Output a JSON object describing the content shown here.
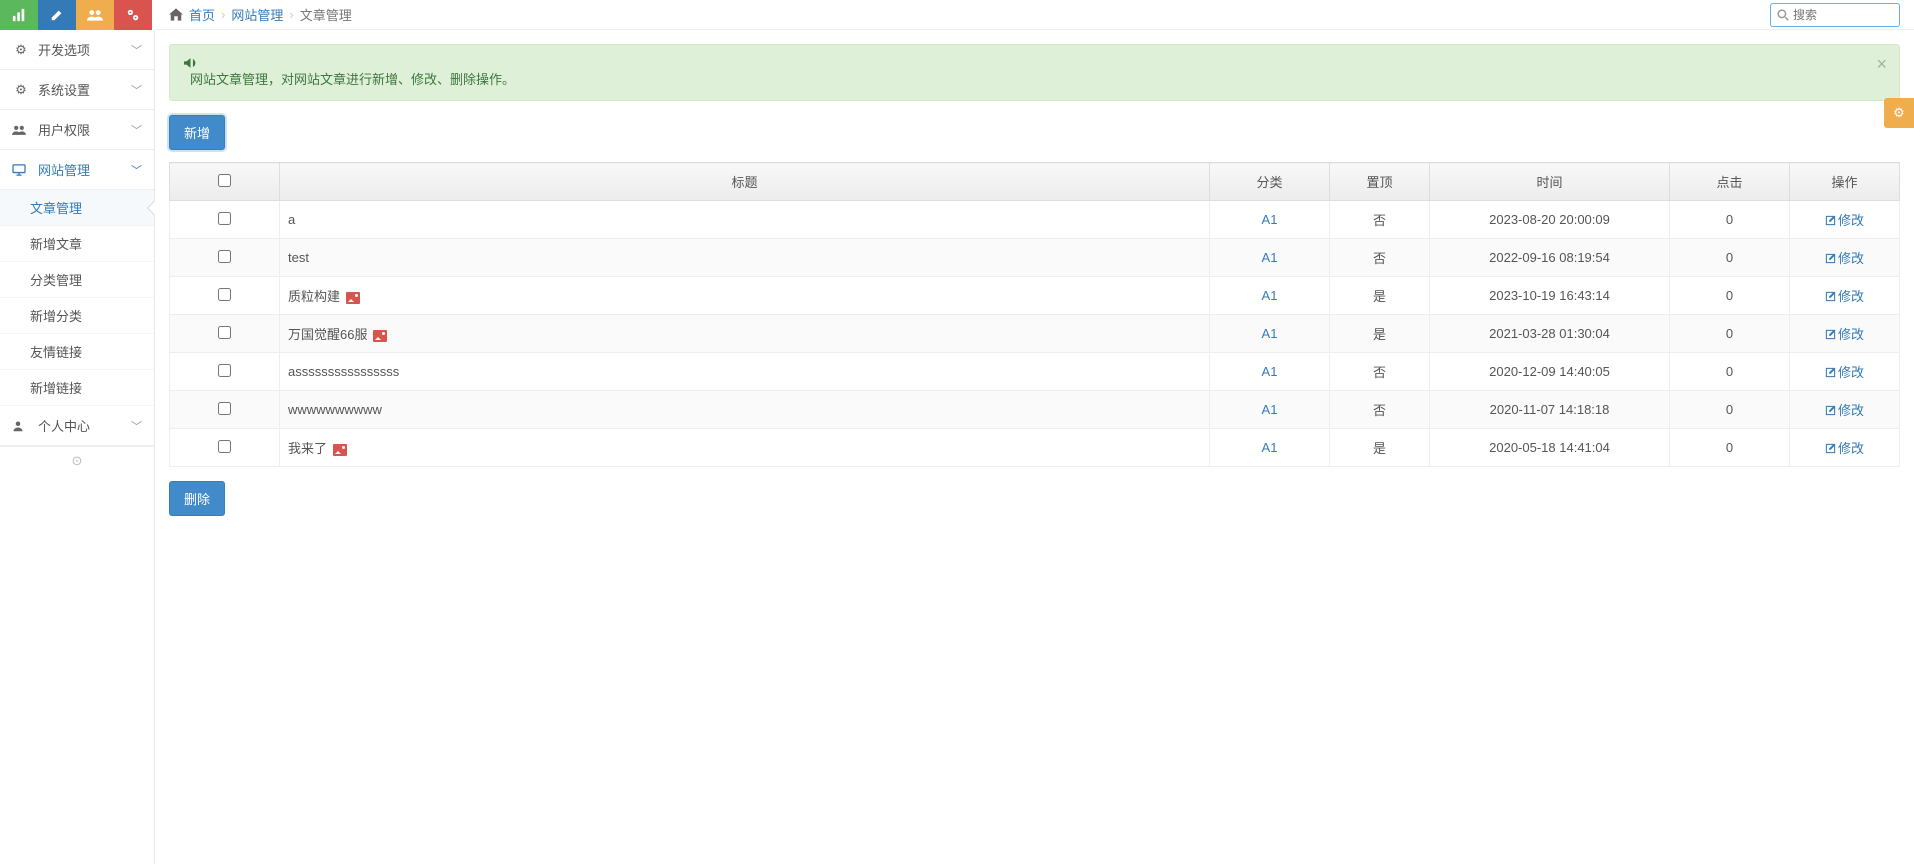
{
  "topbuttons": [
    "chart",
    "edit",
    "users",
    "cogs"
  ],
  "breadcrumb": {
    "home_icon": "home",
    "home": "首页",
    "section": "网站管理",
    "current": "文章管理"
  },
  "search": {
    "placeholder": "搜索"
  },
  "sidebar": {
    "items": [
      {
        "icon": "gear",
        "label": "开发选项"
      },
      {
        "icon": "gear",
        "label": "系统设置"
      },
      {
        "icon": "users",
        "label": "用户权限"
      },
      {
        "icon": "monitor",
        "label": "网站管理",
        "active": true
      },
      {
        "icon": "user",
        "label": "个人中心"
      }
    ],
    "submenu_site": [
      {
        "label": "文章管理",
        "active": true
      },
      {
        "label": "新增文章"
      },
      {
        "label": "分类管理"
      },
      {
        "label": "新增分类"
      },
      {
        "label": "友情链接"
      },
      {
        "label": "新增链接"
      }
    ]
  },
  "alert": {
    "text": "网站文章管理，对网站文章进行新增、修改、删除操作。"
  },
  "buttons": {
    "add": "新增",
    "delete": "删除",
    "edit": "修改"
  },
  "table": {
    "headers": [
      "",
      "标题",
      "分类",
      "置顶",
      "时间",
      "点击",
      "操作"
    ],
    "rows": [
      {
        "title": "a",
        "has_img": false,
        "category": "A1",
        "pinned": "否",
        "time": "2023-08-20 20:00:09",
        "clicks": "0"
      },
      {
        "title": "test",
        "has_img": false,
        "category": "A1",
        "pinned": "否",
        "time": "2022-09-16 08:19:54",
        "clicks": "0"
      },
      {
        "title": "质粒构建",
        "has_img": true,
        "category": "A1",
        "pinned": "是",
        "time": "2023-10-19 16:43:14",
        "clicks": "0"
      },
      {
        "title": "万国觉醒66服",
        "has_img": true,
        "category": "A1",
        "pinned": "是",
        "time": "2021-03-28 01:30:04",
        "clicks": "0"
      },
      {
        "title": "assssssssssssssss",
        "has_img": false,
        "category": "A1",
        "pinned": "否",
        "time": "2020-12-09 14:40:05",
        "clicks": "0"
      },
      {
        "title": "wwwwwwwwww",
        "has_img": false,
        "category": "A1",
        "pinned": "否",
        "time": "2020-11-07 14:18:18",
        "clicks": "0"
      },
      {
        "title": "我来了",
        "has_img": true,
        "category": "A1",
        "pinned": "是",
        "time": "2020-05-18 14:41:04",
        "clicks": "0"
      }
    ]
  }
}
